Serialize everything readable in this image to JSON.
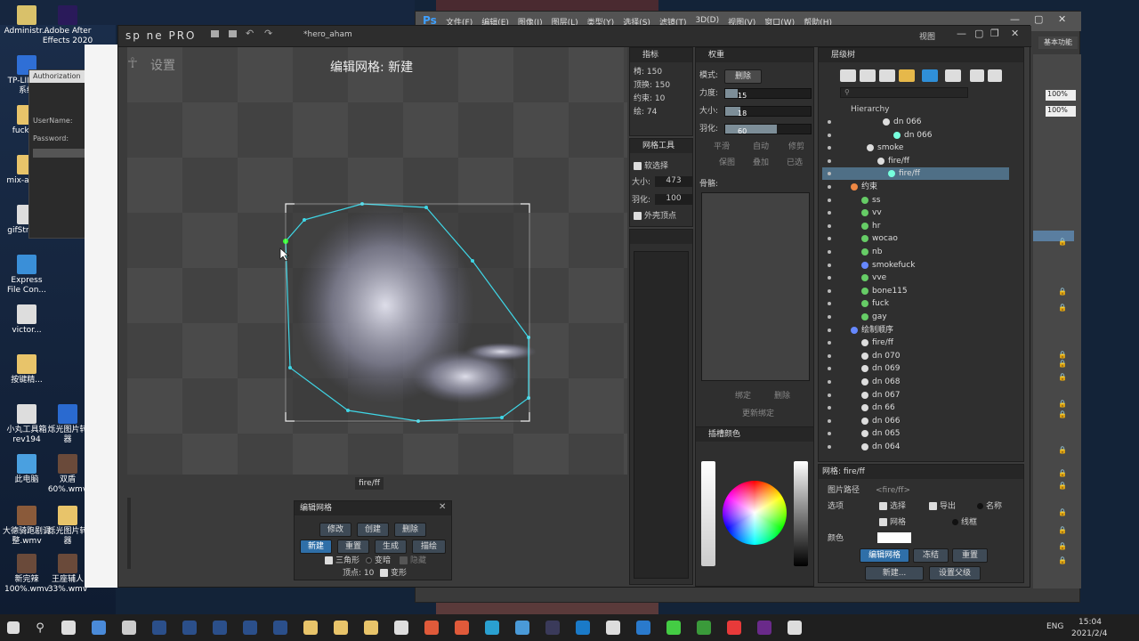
{
  "desktop": {
    "icons": [
      {
        "label": "Administr...",
        "color": "#d9c16a"
      },
      {
        "label": "TP-LINK...\n系统",
        "color": "#2f6fd6"
      },
      {
        "label": "fuckc...",
        "color": "#e8c46a"
      },
      {
        "label": "mix-and...",
        "color": "#e8c46a"
      },
      {
        "label": "gifStrok...",
        "color": "#ddd"
      },
      {
        "label": "Express\nFile Con...",
        "color": "#3a8fd8"
      },
      {
        "label": "victor...",
        "color": "#ddd"
      },
      {
        "label": "按键精...",
        "color": "#e8c46a"
      },
      {
        "label": "小丸工具箱\nrev194",
        "color": "#ddd"
      },
      {
        "label": "此电脑",
        "color": "#4aa0e0"
      },
      {
        "label": "大德骑跑剧调\n整.wmv",
        "color": "#8a5a3a"
      },
      {
        "label": "新完辣\n100%.wmv",
        "color": "#6a4a3a"
      },
      {
        "label": "Adobe After\nEffects 2020",
        "color": "#2a1a5a"
      },
      {
        "label": "烁光图片转\n器",
        "color": "#2a6ad0"
      },
      {
        "label": "双盾\n60%.wmv",
        "color": "#6a4a3a"
      },
      {
        "label": "烁光图片转\n器",
        "color": "#e8c46a"
      },
      {
        "label": "王座辅人\n33%.wmv",
        "color": "#6a4a3a"
      }
    ]
  },
  "photoshop": {
    "logo": "Ps",
    "menus": [
      "文件(F)",
      "编辑(E)",
      "图像(I)",
      "图层(L)",
      "类型(Y)",
      "选择(S)",
      "滤镜(T)",
      "3D(D)",
      "视图(V)",
      "窗口(W)",
      "帮助(H)"
    ],
    "workspace": "基本功能",
    "zoom1": "100%",
    "zoom2": "100%",
    "view_label": "视图"
  },
  "spine": {
    "logo": "sp ne PRO",
    "file": "*hero_aham",
    "settings": "设置",
    "title": "编辑网格: 新建",
    "attachment_label": "fire/ff",
    "edit_mesh": {
      "title": "编辑网格",
      "buttons": [
        "修改",
        "创建",
        "删除",
        "新建",
        "重置",
        "生成",
        "描绘"
      ],
      "triangles": "三角形",
      "dim": "变暗",
      "hide": "隐藏",
      "vertices_label": "顶点:",
      "vertices": "10",
      "deform": "变形"
    },
    "metrics": {
      "title": "指标",
      "rows": [
        "椅: 150",
        "顶换: 150",
        "约束: 10",
        "绘: 74"
      ]
    },
    "weights": {
      "title": "权重",
      "mode_label": "模式:",
      "mode_value": "删除",
      "force_label": "力度:",
      "force": 15,
      "size_label": "大小:",
      "size": 18,
      "feather_label": "羽化:",
      "feather": 60,
      "smooth": "平滑",
      "auto": "自动",
      "prune": "修剪",
      "lock": "保图",
      "overlay": "叠加",
      "selected": "已选",
      "bones_label": "骨骼:",
      "bind": "绑定",
      "remove": "删除",
      "update_bind": "更新绑定"
    },
    "mesh_tools": {
      "title": "网格工具",
      "soft_select": "软选择",
      "size_label": "大小:",
      "size": "473",
      "feather_label": "羽化:",
      "feather": "100",
      "outline": "外壳顶点"
    },
    "tree": {
      "title": "层级树",
      "root": "Hierarchy",
      "items": [
        {
          "t": "dn 066",
          "ind": 68,
          "ico": "#ddd"
        },
        {
          "t": "dn 066",
          "ind": 80,
          "ico": "#7fd"
        },
        {
          "t": "smoke",
          "ind": 50,
          "ico": "#ddd"
        },
        {
          "t": "fire/ff",
          "ind": 62,
          "ico": "#ddd"
        },
        {
          "t": "fire/ff",
          "ind": 74,
          "ico": "#7fd",
          "sel": true
        },
        {
          "t": "约束",
          "ind": 32,
          "ico": "#e84"
        },
        {
          "t": "ss",
          "ind": 44,
          "ico": "#6c6"
        },
        {
          "t": "vv",
          "ind": 44,
          "ico": "#6c6"
        },
        {
          "t": "hr",
          "ind": 44,
          "ico": "#6c6"
        },
        {
          "t": "wocao",
          "ind": 44,
          "ico": "#6c6"
        },
        {
          "t": "nb",
          "ind": 44,
          "ico": "#6c6"
        },
        {
          "t": "smokefuck",
          "ind": 44,
          "ico": "#68f"
        },
        {
          "t": "vve",
          "ind": 44,
          "ico": "#6c6"
        },
        {
          "t": "bone115",
          "ind": 44,
          "ico": "#6c6"
        },
        {
          "t": "fuck",
          "ind": 44,
          "ico": "#6c6"
        },
        {
          "t": "gay",
          "ind": 44,
          "ico": "#6c6"
        },
        {
          "t": "绘制顺序",
          "ind": 32,
          "ico": "#68f"
        },
        {
          "t": "fire/ff",
          "ind": 44,
          "ico": "#ddd"
        },
        {
          "t": "dn 070",
          "ind": 44,
          "ico": "#ddd"
        },
        {
          "t": "dn 069",
          "ind": 44,
          "ico": "#ddd"
        },
        {
          "t": "dn 068",
          "ind": 44,
          "ico": "#ddd"
        },
        {
          "t": "dn 067",
          "ind": 44,
          "ico": "#ddd"
        },
        {
          "t": "dn 66",
          "ind": 44,
          "ico": "#ddd"
        },
        {
          "t": "dn 066",
          "ind": 44,
          "ico": "#ddd"
        },
        {
          "t": "dn 065",
          "ind": 44,
          "ico": "#ddd"
        },
        {
          "t": "dn 064",
          "ind": 44,
          "ico": "#ddd"
        }
      ]
    },
    "mesh_props": {
      "title": "网格: fire/ff",
      "path_label": "图片路径",
      "path_value": "<fire/ff>",
      "options_label": "选项",
      "select": "选择",
      "export": "导出",
      "name": "名称",
      "mesh": "网格",
      "wire": "线框",
      "color_label": "颜色",
      "edit_mesh": "编辑网格",
      "freeze": "冻结",
      "reset": "重置",
      "new": "新建...",
      "set_parent": "设置父级"
    },
    "slot_color": {
      "title": "插槽颜色"
    }
  },
  "login": {
    "title": "Authorization",
    "user": "UserName:",
    "pass": "Password:"
  },
  "taskbar": {
    "time": "15:04",
    "date": "2021/2/4",
    "lang": "ENG"
  },
  "colors": {
    "accent": "#2f6fa8",
    "mesh": "#3fd6e6",
    "selected": "#4f6f86"
  }
}
